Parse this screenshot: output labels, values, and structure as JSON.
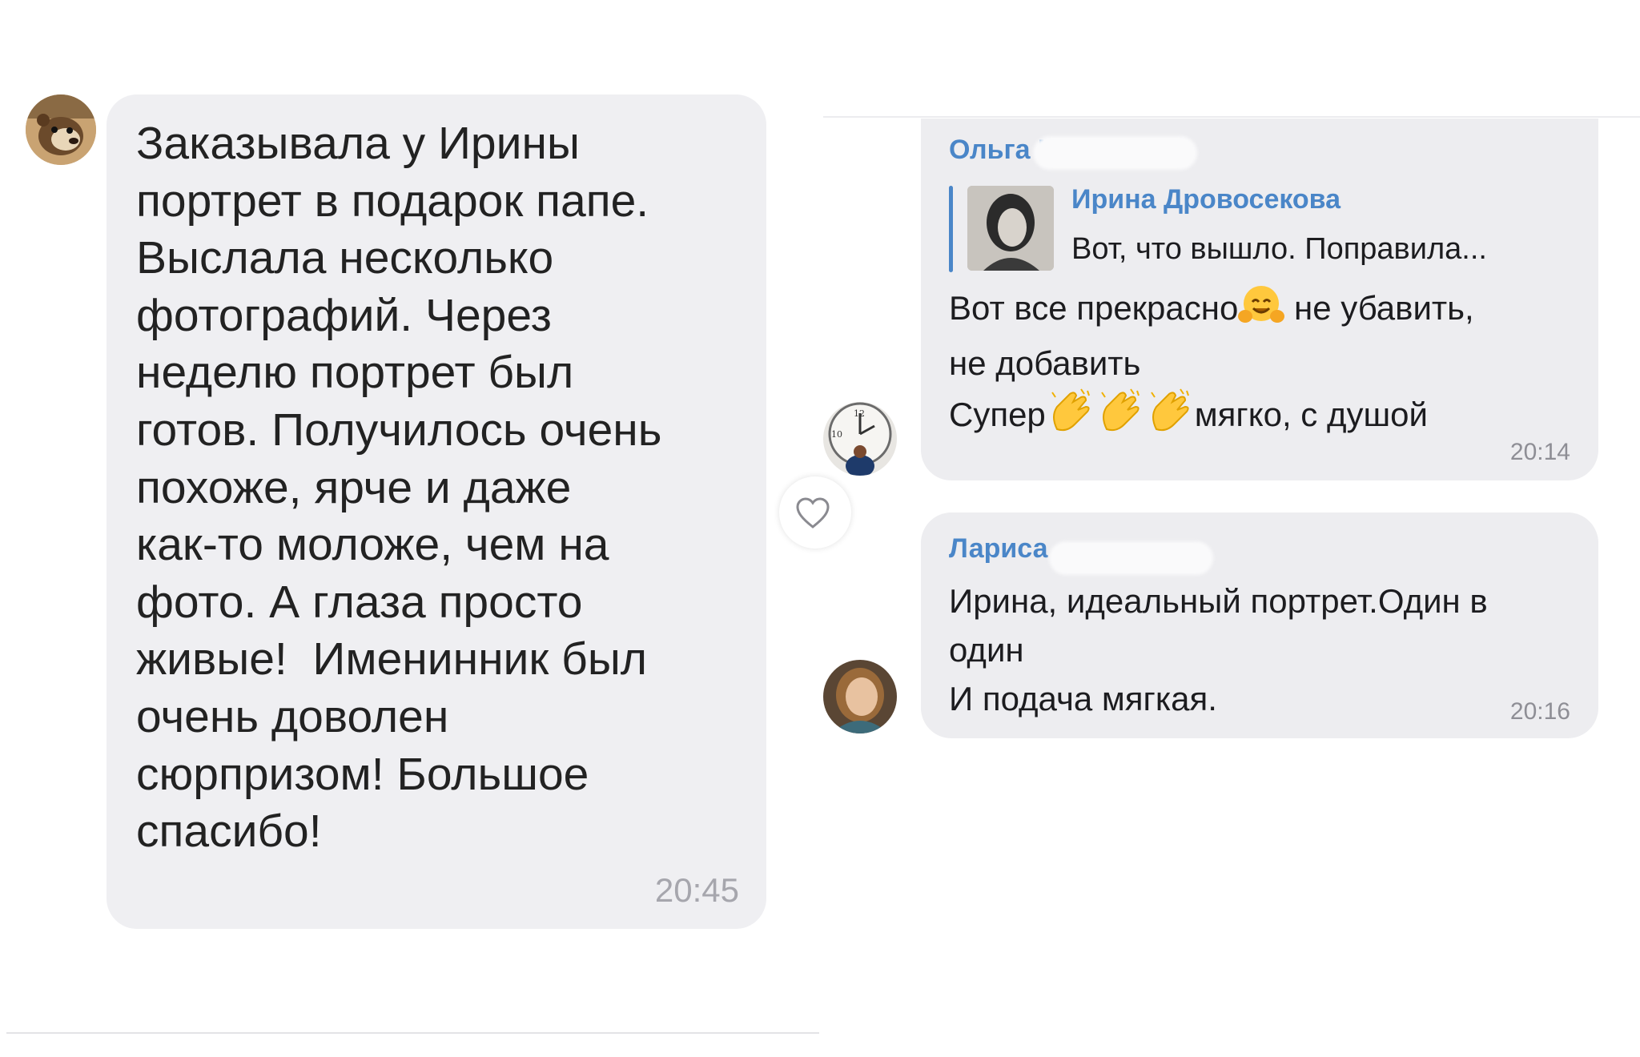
{
  "left_chat": {
    "message": "Заказывала у Ирины\nпортрет в подарок папе.\nВыслала несколько\nфотографий. Через\nнеделю портрет был\nготов. Получилось очень\nпохоже, ярче и даже\nкак-то моложе, чем на\nфото. А глаза просто\nживые!  Именинник был\nочень доволен\nсюрпризом! Большое\nспасибо!",
    "time": "20:45"
  },
  "right_chat": {
    "message1": {
      "author": "Ольга К",
      "reply_author": "Ирина Дровосекова",
      "reply_text": "Вот, что вышло. Поправила...",
      "line1_a": "Вот все прекрасно",
      "line1_b": " не убавить,",
      "line2": "не добавить",
      "line3_a": "Супер",
      "line3_b": "мягко, с душой",
      "time": "20:14"
    },
    "message2": {
      "author": "Лариса",
      "text": "Ирина, идеальный портрет.Один в\nодин\nИ подача мягкая.",
      "time": "20:16"
    }
  },
  "colors": {
    "bubble_left": "#efeff2",
    "bubble_right": "#ededf0",
    "name_link": "#4a86c8",
    "time_gray": "#8e8e95"
  },
  "icons": [
    "user-avatar-bear",
    "heart-icon",
    "user-avatar-clock",
    "user-avatar-woman",
    "hugging-face-emoji",
    "clapping-hands-emoji"
  ]
}
